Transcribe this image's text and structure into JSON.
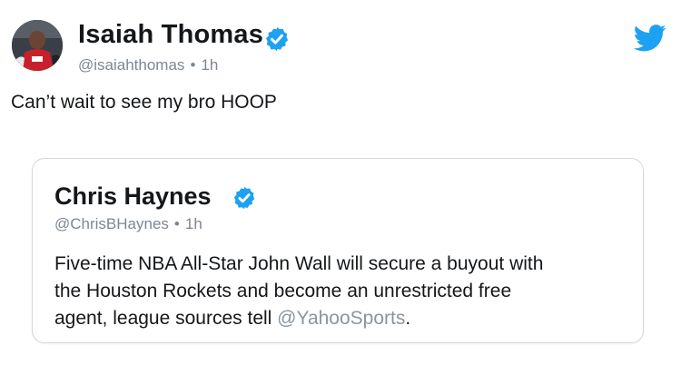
{
  "tweet": {
    "author_name": "Isaiah Thomas",
    "handle": "@isaiahthomas",
    "separator": "•",
    "time": "1h",
    "text": "Can’t wait to see my bro HOOP"
  },
  "quoted_tweet": {
    "author_name": "Chris Haynes",
    "handle": "@ChrisBHaynes",
    "separator": "•",
    "time": "1h",
    "line1": "Five-time NBA All-Star John Wall will secure a buyout with",
    "line2": "the Houston Rockets and become an unrestricted free",
    "line3_prefix": "agent, league sources tell ",
    "mention": "@YahooSports",
    "line3_suffix": "."
  },
  "icons": {
    "verified": "verified-badge-icon",
    "brand": "twitter-bird-icon",
    "avatar": "avatar-photo"
  },
  "colors": {
    "verified_blue": "#1da1f2",
    "twitter_blue": "#1da1f2",
    "meta_gray": "#7d8791",
    "text": "#14171a",
    "card_border": "#d2d9df"
  }
}
